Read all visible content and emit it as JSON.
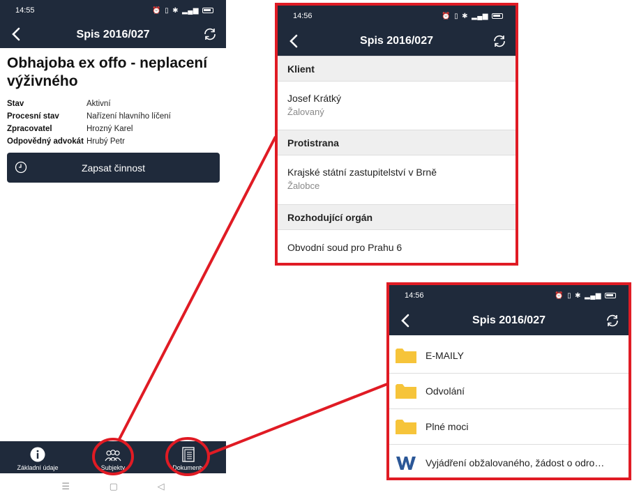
{
  "main": {
    "time": "14:55",
    "title": "Spis 2016/027",
    "case_title": "Obhajoba ex offo - neplacení výživného",
    "info": [
      {
        "label": "Stav",
        "value": "Aktivní"
      },
      {
        "label": "Procesní stav",
        "value": "Nařízení hlavního líčení"
      },
      {
        "label": "Zpracovatel",
        "value": "Hrozný Karel"
      },
      {
        "label": "Odpovědný advokát",
        "value": "Hrubý Petr"
      }
    ],
    "action_label": "Zapsat činnost",
    "nav": [
      {
        "label": "Základní údaje",
        "icon": "info-icon"
      },
      {
        "label": "Subjekty",
        "icon": "people-icon"
      },
      {
        "label": "Dokumenty",
        "icon": "documents-icon"
      }
    ]
  },
  "subjects_view": {
    "time": "14:56",
    "title": "Spis 2016/027",
    "sections": [
      {
        "header": "Klient",
        "name": "Josef Krátký",
        "role": "Žalovaný"
      },
      {
        "header": "Protistrana",
        "name": "Krajské státní zastupitelství v Brně",
        "role": "Žalobce"
      },
      {
        "header": "Rozhodující orgán",
        "name": "Obvodní soud pro Prahu 6",
        "role": ""
      }
    ]
  },
  "documents_view": {
    "time": "14:56",
    "title": "Spis 2016/027",
    "items": [
      {
        "name": "E-MAILY",
        "icon": "folder-icon"
      },
      {
        "name": "Odvolání",
        "icon": "folder-icon"
      },
      {
        "name": "Plné moci",
        "icon": "folder-icon"
      },
      {
        "name": "Vyjádření obžalovaného, žádost o odro…",
        "icon": "word-icon"
      }
    ]
  },
  "colors": {
    "navy": "#1f2a3b",
    "highlight_red": "#e01b24",
    "folder_yellow": "#f6c43a",
    "word_blue": "#2b5797"
  }
}
